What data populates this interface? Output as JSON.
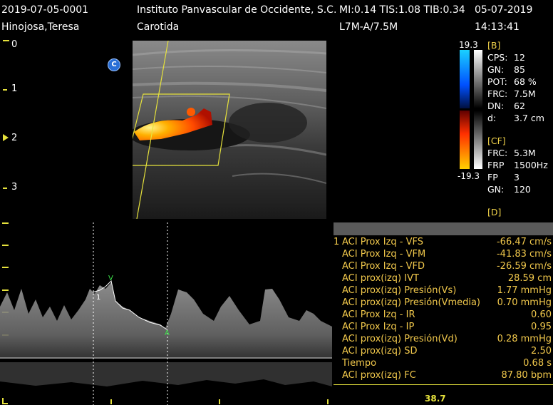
{
  "header": {
    "id": "2019-07-05-0001",
    "patient": "Hinojosa,Teresa",
    "institution": "Instituto Panvascular de Occidente, S.C.",
    "indices": "MI:0.14  TIS:1.08  TIB:0.34",
    "date": "05-07-2019",
    "exam": "Carotida",
    "probe": "L7M-A/7.5M",
    "time": "14:13:41"
  },
  "depth_labels": [
    "0",
    "1",
    "2",
    "3"
  ],
  "color_scale": {
    "max": "19.3",
    "min": "-19.3"
  },
  "badge": "C",
  "bmode": {
    "title": "[B]",
    "rows": [
      {
        "k": "CPS:",
        "v": "12"
      },
      {
        "k": "GN:",
        "v": "85"
      },
      {
        "k": "POT:",
        "v": "68 %"
      },
      {
        "k": "FRC:",
        "v": "7.5M"
      },
      {
        "k": "DN:",
        "v": "62"
      },
      {
        "k": "d:",
        "v": "3.7 cm"
      }
    ]
  },
  "cf": {
    "title": "[CF]",
    "rows": [
      {
        "k": "FRC:",
        "v": "5.3M"
      },
      {
        "k": "FRP",
        "v": "1500Hz"
      },
      {
        "k": "FP",
        "v": "3"
      },
      {
        "k": "GN:",
        "v": "120"
      }
    ]
  },
  "d_title": "[D]",
  "measurements": [
    {
      "idx": "1",
      "label": "ACI Prox Izq - VFS",
      "value": "-66.47 cm/s"
    },
    {
      "idx": "",
      "label": "ACI Prox Izq - VFM",
      "value": "-41.83 cm/s"
    },
    {
      "idx": "",
      "label": "ACI Prox Izq - VFD",
      "value": "-26.59 cm/s"
    },
    {
      "idx": "",
      "label": "ACI prox(izq) IVT",
      "value": "28.59 cm"
    },
    {
      "idx": "",
      "label": "ACI prox(izq) Presión(Vs)",
      "value": "1.77 mmHg"
    },
    {
      "idx": "",
      "label": "ACI prox(izq) Presión(Vmedia)",
      "value": "0.70 mmHg"
    },
    {
      "idx": "",
      "label": "ACI Prox Izq - IR",
      "value": "0.60"
    },
    {
      "idx": "",
      "label": "ACI Prox Izq - IP",
      "value": "0.95"
    },
    {
      "idx": "",
      "label": "ACI prox(izq) Presión(Vd)",
      "value": "0.28 mmHg"
    },
    {
      "idx": "",
      "label": "ACI prox(izq) SD",
      "value": "2.50"
    },
    {
      "idx": "",
      "label": "Tiempo",
      "value": "0.68 s"
    },
    {
      "idx": "",
      "label": "ACI prox(izq) FC",
      "value": "87.80 bpm"
    }
  ],
  "doppler_markers": {
    "m1": "1",
    "v": "V",
    "a": "A"
  },
  "bottom_value": "38.7"
}
